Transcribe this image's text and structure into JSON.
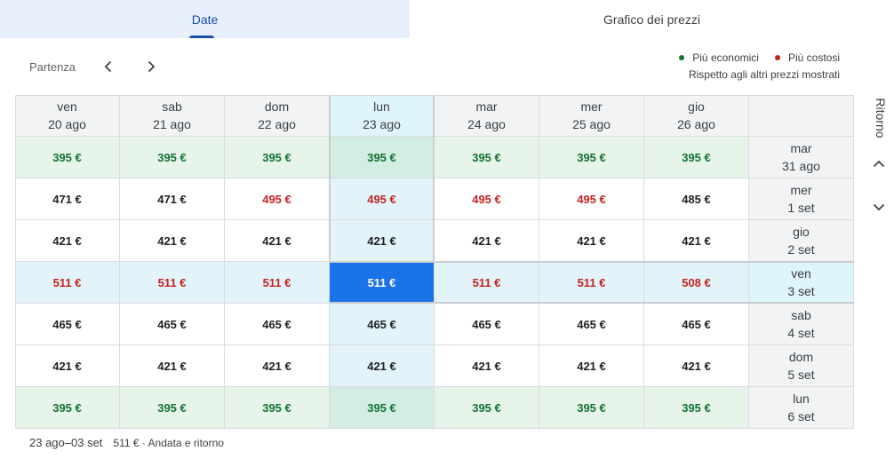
{
  "tabs": [
    {
      "label": "Date",
      "active": true
    },
    {
      "label": "Grafico dei prezzi",
      "active": false
    }
  ],
  "departure": {
    "label": "Partenza"
  },
  "legend": {
    "cheaper": {
      "label": "Più economici",
      "color": "#137333"
    },
    "pricier": {
      "label": "Più costosi",
      "color": "#c5221f"
    },
    "note": "Rispetto agli altri prezzi mostrati"
  },
  "return_label": "Ritorno",
  "columns": [
    {
      "day": "ven",
      "date": "20 ago"
    },
    {
      "day": "sab",
      "date": "21 ago"
    },
    {
      "day": "dom",
      "date": "22 ago"
    },
    {
      "day": "lun",
      "date": "23 ago"
    },
    {
      "day": "mar",
      "date": "24 ago"
    },
    {
      "day": "mer",
      "date": "25 ago"
    },
    {
      "day": "gio",
      "date": "26 ago"
    }
  ],
  "rows": [
    {
      "day": "mar",
      "date": "31 ago",
      "prices": [
        {
          "v": "395 €",
          "c": "green"
        },
        {
          "v": "395 €",
          "c": "green"
        },
        {
          "v": "395 €",
          "c": "green"
        },
        {
          "v": "395 €",
          "c": "green"
        },
        {
          "v": "395 €",
          "c": "green"
        },
        {
          "v": "395 €",
          "c": "green"
        },
        {
          "v": "395 €",
          "c": "green"
        }
      ]
    },
    {
      "day": "mer",
      "date": "1 set",
      "prices": [
        {
          "v": "471 €",
          "c": "black"
        },
        {
          "v": "471 €",
          "c": "black"
        },
        {
          "v": "495 €",
          "c": "red"
        },
        {
          "v": "495 €",
          "c": "red"
        },
        {
          "v": "495 €",
          "c": "red"
        },
        {
          "v": "495 €",
          "c": "red"
        },
        {
          "v": "485 €",
          "c": "black"
        }
      ]
    },
    {
      "day": "gio",
      "date": "2 set",
      "prices": [
        {
          "v": "421 €",
          "c": "black"
        },
        {
          "v": "421 €",
          "c": "black"
        },
        {
          "v": "421 €",
          "c": "black"
        },
        {
          "v": "421 €",
          "c": "black"
        },
        {
          "v": "421 €",
          "c": "black"
        },
        {
          "v": "421 €",
          "c": "black"
        },
        {
          "v": "421 €",
          "c": "black"
        }
      ]
    },
    {
      "day": "ven",
      "date": "3 set",
      "prices": [
        {
          "v": "511 €",
          "c": "red"
        },
        {
          "v": "511 €",
          "c": "red"
        },
        {
          "v": "511 €",
          "c": "red"
        },
        {
          "v": "511 €",
          "c": "selected"
        },
        {
          "v": "511 €",
          "c": "red"
        },
        {
          "v": "511 €",
          "c": "red"
        },
        {
          "v": "508 €",
          "c": "red"
        }
      ]
    },
    {
      "day": "sab",
      "date": "4 set",
      "prices": [
        {
          "v": "465 €",
          "c": "black"
        },
        {
          "v": "465 €",
          "c": "black"
        },
        {
          "v": "465 €",
          "c": "black"
        },
        {
          "v": "465 €",
          "c": "black"
        },
        {
          "v": "465 €",
          "c": "black"
        },
        {
          "v": "465 €",
          "c": "black"
        },
        {
          "v": "465 €",
          "c": "black"
        }
      ]
    },
    {
      "day": "dom",
      "date": "5 set",
      "prices": [
        {
          "v": "421 €",
          "c": "black"
        },
        {
          "v": "421 €",
          "c": "black"
        },
        {
          "v": "421 €",
          "c": "black"
        },
        {
          "v": "421 €",
          "c": "black"
        },
        {
          "v": "421 €",
          "c": "black"
        },
        {
          "v": "421 €",
          "c": "black"
        },
        {
          "v": "421 €",
          "c": "black"
        }
      ]
    },
    {
      "day": "lun",
      "date": "6 set",
      "prices": [
        {
          "v": "395 €",
          "c": "green"
        },
        {
          "v": "395 €",
          "c": "green"
        },
        {
          "v": "395 €",
          "c": "green"
        },
        {
          "v": "395 €",
          "c": "green"
        },
        {
          "v": "395 €",
          "c": "green"
        },
        {
          "v": "395 €",
          "c": "green"
        },
        {
          "v": "395 €",
          "c": "green"
        }
      ]
    }
  ],
  "selected": {
    "departure_index": 3,
    "return_index": 3
  },
  "footer": {
    "dates": "23 ago–03 set",
    "price": "511 € · Andata e ritorno"
  },
  "colors": {
    "accent": "#1a73e8",
    "tab_active": "#1a4fa8"
  }
}
